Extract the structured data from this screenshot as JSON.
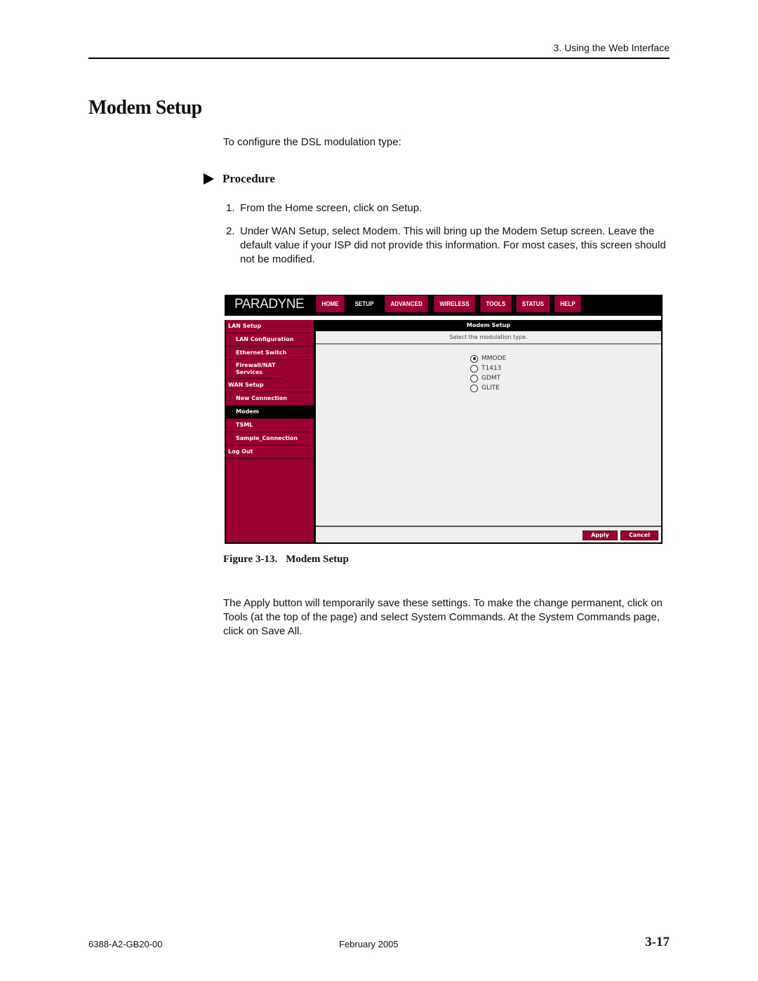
{
  "page": {
    "running_head": "3. Using the Web Interface",
    "title": "Modem Setup",
    "intro": "To configure the DSL modulation type:",
    "procedure_label": "Procedure",
    "steps": [
      {
        "num": "1.",
        "text": "From the Home screen, click on Setup."
      },
      {
        "num": "2.",
        "text": "Under WAN Setup, select Modem. This will bring up the Modem Setup screen. Leave the default value if your ISP did not provide this information.  For most cases, this screen should not be modified."
      }
    ],
    "figure_caption_num": "Figure 3-13.",
    "figure_caption_title": "Modem Setup",
    "after_text": "The Apply button will temporarily save these settings. To make the change permanent, click on Tools (at the top of the page) and select System Commands. At the System Commands page, click on Save All.",
    "footer": {
      "doc_id": "6388-A2-GB20-00",
      "date": "February 2005",
      "page_number": "3-17"
    }
  },
  "ui": {
    "logo": "PARADYNE",
    "tabs": [
      {
        "label": "HOME",
        "active": false
      },
      {
        "label": "SETUP",
        "active": true
      },
      {
        "label": "ADVANCED",
        "active": false
      },
      {
        "label": "WIRELESS",
        "active": false
      },
      {
        "label": "TOOLS",
        "active": false
      },
      {
        "label": "STATUS",
        "active": false
      },
      {
        "label": "HELP",
        "active": false
      }
    ],
    "sidebar": [
      {
        "label": "LAN Setup",
        "sub": false
      },
      {
        "label": "LAN Configuration",
        "sub": true
      },
      {
        "label": "Ethernet Switch",
        "sub": true
      },
      {
        "label": "Firewall/NAT Services",
        "sub": true
      },
      {
        "label": "WAN Setup",
        "sub": false
      },
      {
        "label": "New Connection",
        "sub": true
      },
      {
        "label": "Modem",
        "sub": true,
        "active": true
      },
      {
        "label": "TSML",
        "sub": true
      },
      {
        "label": "Sample_Connection",
        "sub": true
      },
      {
        "label": "Log Out",
        "sub": false
      }
    ],
    "content_title": "Modem Setup",
    "content_subtitle": "Select the modulation type.",
    "modulation_options": [
      {
        "label": "MMODE",
        "checked": true
      },
      {
        "label": "T1413",
        "checked": false
      },
      {
        "label": "GDMT",
        "checked": false
      },
      {
        "label": "GLITE",
        "checked": false
      }
    ],
    "apply_label": "Apply",
    "cancel_label": "Cancel",
    "colors": {
      "brand": "#9a0030",
      "bar": "#000000",
      "panel": "#efefef"
    }
  }
}
